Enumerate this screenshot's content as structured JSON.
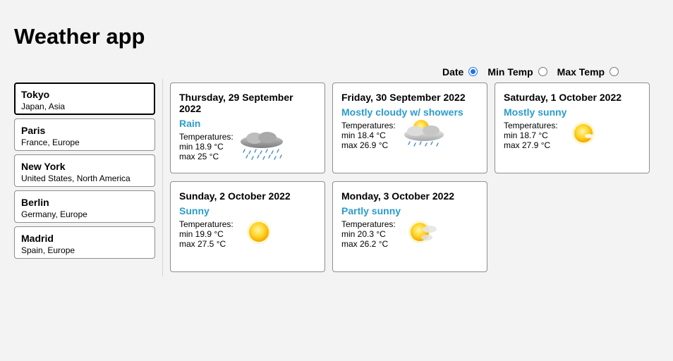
{
  "app": {
    "title": "Weather app"
  },
  "sort": {
    "options": [
      {
        "label": "Date",
        "checked": true
      },
      {
        "label": "Min Temp",
        "checked": false
      },
      {
        "label": "Max Temp",
        "checked": false
      }
    ]
  },
  "cities": [
    {
      "name": "Tokyo",
      "region": "Japan, Asia",
      "selected": true
    },
    {
      "name": "Paris",
      "region": "France, Europe",
      "selected": false
    },
    {
      "name": "New York",
      "region": "United States, North America",
      "selected": false
    },
    {
      "name": "Berlin",
      "region": "Germany, Europe",
      "selected": false
    },
    {
      "name": "Madrid",
      "region": "Spain, Europe",
      "selected": false
    }
  ],
  "forecast": [
    {
      "date": "Thursday, 29 September 2022",
      "condition": "Rain",
      "temps_label": "Temperatures:",
      "min": "min 18.9 °C",
      "max": "max 25 °C",
      "icon": "rain-icon"
    },
    {
      "date": "Friday, 30 September 2022",
      "condition": "Mostly cloudy w/ showers",
      "temps_label": "Temperatures:",
      "min": "min 18.4 °C",
      "max": "max 26.9 °C",
      "icon": "cloudy-showers-icon"
    },
    {
      "date": "Saturday, 1 October 2022",
      "condition": "Mostly sunny",
      "temps_label": "Temperatures:",
      "min": "min 18.7 °C",
      "max": "max 27.9 °C",
      "icon": "mostly-sunny-icon"
    },
    {
      "date": "Sunday, 2 October 2022",
      "condition": "Sunny",
      "temps_label": "Temperatures:",
      "min": "min 19.9 °C",
      "max": "max 27.5 °C",
      "icon": "sun-icon"
    },
    {
      "date": "Monday, 3 October 2022",
      "condition": "Partly sunny",
      "temps_label": "Temperatures:",
      "min": "min 20.3 °C",
      "max": "max 26.2 °C",
      "icon": "partly-sunny-icon"
    }
  ],
  "colors": {
    "accent": "#2b9ccc",
    "background": "#f3f3f3",
    "radio": "#1a73e8"
  }
}
